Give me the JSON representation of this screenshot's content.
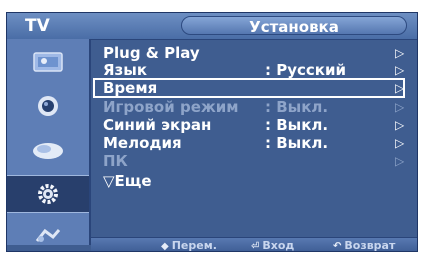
{
  "header": {
    "source_label": "TV",
    "title": "Установка"
  },
  "sidebar": {
    "items": [
      {
        "icon": "picture-icon",
        "active": false
      },
      {
        "icon": "sound-icon",
        "active": false
      },
      {
        "icon": "channel-icon",
        "active": false
      },
      {
        "icon": "setup-icon",
        "active": true
      },
      {
        "icon": "input-icon",
        "active": false
      }
    ]
  },
  "menu": {
    "items": [
      {
        "label": "Plug & Play",
        "value": "",
        "arrow": "▷",
        "state": "normal"
      },
      {
        "label": "Язык",
        "value": ": Русский",
        "arrow": "▷",
        "state": "normal"
      },
      {
        "label": "Время",
        "value": "",
        "arrow": "▷",
        "state": "selected"
      },
      {
        "label": "Игровой режим",
        "value": ": Выкл.",
        "arrow": "▷",
        "state": "dim"
      },
      {
        "label": "Синий экран",
        "value": ": Выкл.",
        "arrow": "▷",
        "state": "normal"
      },
      {
        "label": "Мелодия",
        "value": ": Выкл.",
        "arrow": "▷",
        "state": "normal"
      },
      {
        "label": "ПК",
        "value": "",
        "arrow": "▷",
        "state": "dim"
      },
      {
        "label": "▽Еще",
        "value": "",
        "arrow": "",
        "state": "normal"
      }
    ]
  },
  "footer": {
    "move": {
      "icon": "◆",
      "label": "Перем."
    },
    "enter": {
      "icon": "⏎",
      "label": "Вход"
    },
    "return": {
      "icon": "↶",
      "label": "Возврат"
    }
  },
  "colors": {
    "panel": "#3f5d90",
    "sidebar": "#5e7eb6",
    "active_tab": "#283f6c",
    "text": "#ffffff",
    "dim_text": "#8ea4c9"
  }
}
